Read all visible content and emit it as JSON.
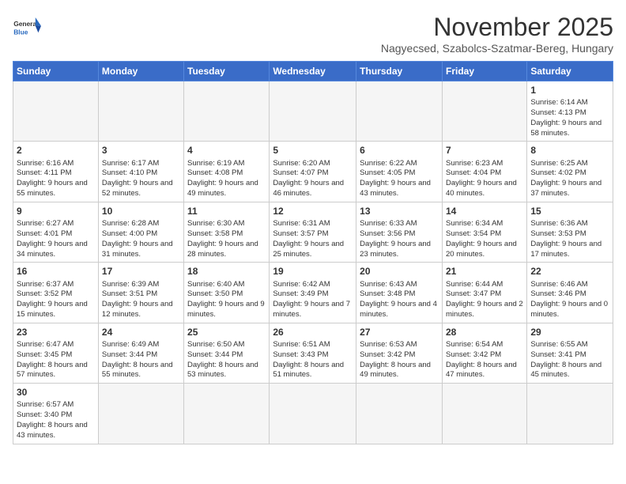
{
  "header": {
    "logo_general": "General",
    "logo_blue": "Blue",
    "month_title": "November 2025",
    "location": "Nagyecsed, Szabolcs-Szatmar-Bereg, Hungary"
  },
  "weekdays": [
    "Sunday",
    "Monday",
    "Tuesday",
    "Wednesday",
    "Thursday",
    "Friday",
    "Saturday"
  ],
  "weeks": [
    [
      {
        "day": null
      },
      {
        "day": null
      },
      {
        "day": null
      },
      {
        "day": null
      },
      {
        "day": null
      },
      {
        "day": null
      },
      {
        "day": 1,
        "sunrise": "6:14 AM",
        "sunset": "4:13 PM",
        "daylight": "9 hours and 58 minutes."
      }
    ],
    [
      {
        "day": 2,
        "sunrise": "6:16 AM",
        "sunset": "4:11 PM",
        "daylight": "9 hours and 55 minutes."
      },
      {
        "day": 3,
        "sunrise": "6:17 AM",
        "sunset": "4:10 PM",
        "daylight": "9 hours and 52 minutes."
      },
      {
        "day": 4,
        "sunrise": "6:19 AM",
        "sunset": "4:08 PM",
        "daylight": "9 hours and 49 minutes."
      },
      {
        "day": 5,
        "sunrise": "6:20 AM",
        "sunset": "4:07 PM",
        "daylight": "9 hours and 46 minutes."
      },
      {
        "day": 6,
        "sunrise": "6:22 AM",
        "sunset": "4:05 PM",
        "daylight": "9 hours and 43 minutes."
      },
      {
        "day": 7,
        "sunrise": "6:23 AM",
        "sunset": "4:04 PM",
        "daylight": "9 hours and 40 minutes."
      },
      {
        "day": 8,
        "sunrise": "6:25 AM",
        "sunset": "4:02 PM",
        "daylight": "9 hours and 37 minutes."
      }
    ],
    [
      {
        "day": 9,
        "sunrise": "6:27 AM",
        "sunset": "4:01 PM",
        "daylight": "9 hours and 34 minutes."
      },
      {
        "day": 10,
        "sunrise": "6:28 AM",
        "sunset": "4:00 PM",
        "daylight": "9 hours and 31 minutes."
      },
      {
        "day": 11,
        "sunrise": "6:30 AM",
        "sunset": "3:58 PM",
        "daylight": "9 hours and 28 minutes."
      },
      {
        "day": 12,
        "sunrise": "6:31 AM",
        "sunset": "3:57 PM",
        "daylight": "9 hours and 25 minutes."
      },
      {
        "day": 13,
        "sunrise": "6:33 AM",
        "sunset": "3:56 PM",
        "daylight": "9 hours and 23 minutes."
      },
      {
        "day": 14,
        "sunrise": "6:34 AM",
        "sunset": "3:54 PM",
        "daylight": "9 hours and 20 minutes."
      },
      {
        "day": 15,
        "sunrise": "6:36 AM",
        "sunset": "3:53 PM",
        "daylight": "9 hours and 17 minutes."
      }
    ],
    [
      {
        "day": 16,
        "sunrise": "6:37 AM",
        "sunset": "3:52 PM",
        "daylight": "9 hours and 15 minutes."
      },
      {
        "day": 17,
        "sunrise": "6:39 AM",
        "sunset": "3:51 PM",
        "daylight": "9 hours and 12 minutes."
      },
      {
        "day": 18,
        "sunrise": "6:40 AM",
        "sunset": "3:50 PM",
        "daylight": "9 hours and 9 minutes."
      },
      {
        "day": 19,
        "sunrise": "6:42 AM",
        "sunset": "3:49 PM",
        "daylight": "9 hours and 7 minutes."
      },
      {
        "day": 20,
        "sunrise": "6:43 AM",
        "sunset": "3:48 PM",
        "daylight": "9 hours and 4 minutes."
      },
      {
        "day": 21,
        "sunrise": "6:44 AM",
        "sunset": "3:47 PM",
        "daylight": "9 hours and 2 minutes."
      },
      {
        "day": 22,
        "sunrise": "6:46 AM",
        "sunset": "3:46 PM",
        "daylight": "9 hours and 0 minutes."
      }
    ],
    [
      {
        "day": 23,
        "sunrise": "6:47 AM",
        "sunset": "3:45 PM",
        "daylight": "8 hours and 57 minutes."
      },
      {
        "day": 24,
        "sunrise": "6:49 AM",
        "sunset": "3:44 PM",
        "daylight": "8 hours and 55 minutes."
      },
      {
        "day": 25,
        "sunrise": "6:50 AM",
        "sunset": "3:44 PM",
        "daylight": "8 hours and 53 minutes."
      },
      {
        "day": 26,
        "sunrise": "6:51 AM",
        "sunset": "3:43 PM",
        "daylight": "8 hours and 51 minutes."
      },
      {
        "day": 27,
        "sunrise": "6:53 AM",
        "sunset": "3:42 PM",
        "daylight": "8 hours and 49 minutes."
      },
      {
        "day": 28,
        "sunrise": "6:54 AM",
        "sunset": "3:42 PM",
        "daylight": "8 hours and 47 minutes."
      },
      {
        "day": 29,
        "sunrise": "6:55 AM",
        "sunset": "3:41 PM",
        "daylight": "8 hours and 45 minutes."
      }
    ],
    [
      {
        "day": 30,
        "sunrise": "6:57 AM",
        "sunset": "3:40 PM",
        "daylight": "8 hours and 43 minutes."
      },
      {
        "day": null
      },
      {
        "day": null
      },
      {
        "day": null
      },
      {
        "day": null
      },
      {
        "day": null
      },
      {
        "day": null
      }
    ]
  ]
}
